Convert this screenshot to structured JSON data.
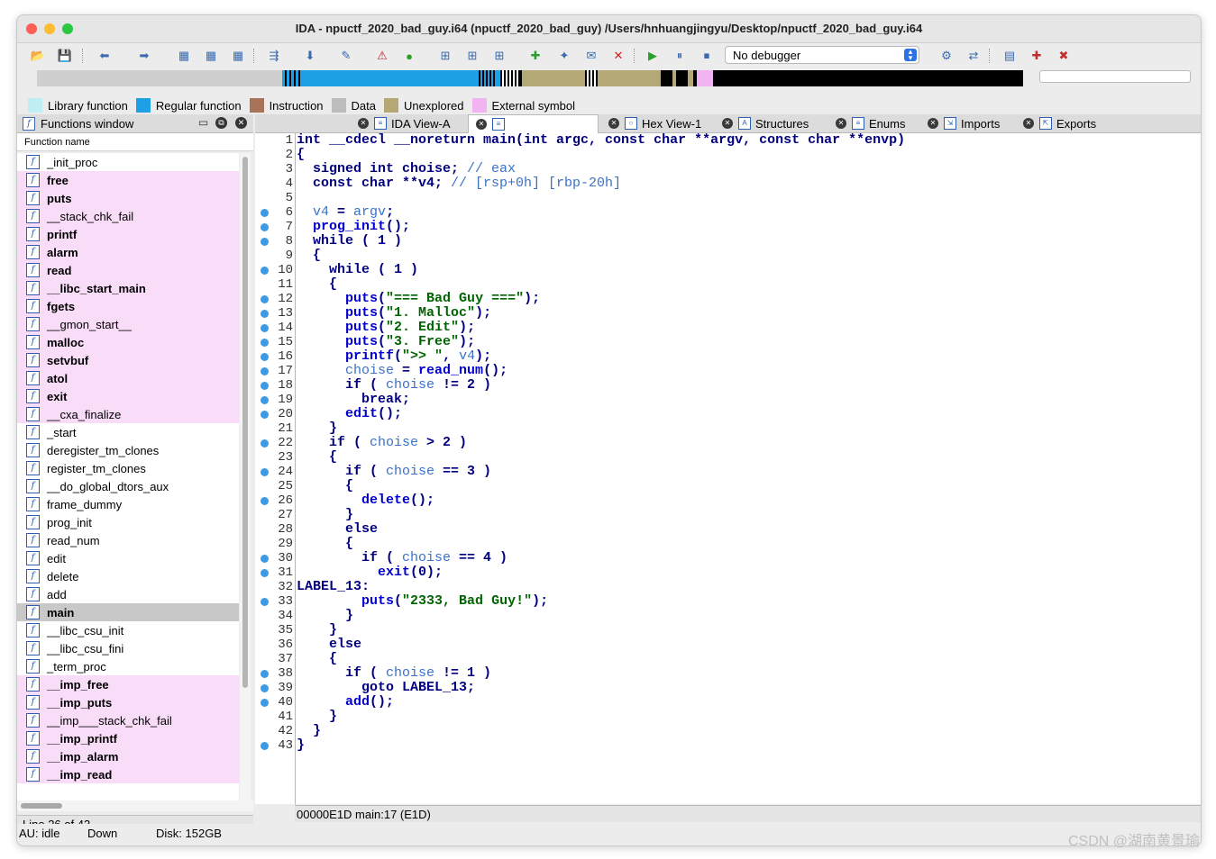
{
  "window": {
    "title": "IDA - npuctf_2020_bad_guy.i64 (npuctf_2020_bad_guy) /Users/hnhuangjingyu/Desktop/npuctf_2020_bad_guy.i64"
  },
  "toolbar": {
    "debugger_value": "No debugger"
  },
  "legend": [
    {
      "label": "Library function",
      "color": "#bfeff3"
    },
    {
      "label": "Regular function",
      "color": "#1ea0e6"
    },
    {
      "label": "Instruction",
      "color": "#a9725a"
    },
    {
      "label": "Data",
      "color": "#bcbcbc"
    },
    {
      "label": "Unexplored",
      "color": "#b5a877"
    },
    {
      "label": "External symbol",
      "color": "#f2b3f2"
    }
  ],
  "functions_panel": {
    "title": "Functions window",
    "column_header": "Function name",
    "line_status": "Line 26 of 43",
    "items": [
      {
        "name": "_init_proc",
        "lib": false,
        "bold": false
      },
      {
        "name": "free",
        "lib": true,
        "bold": true
      },
      {
        "name": "puts",
        "lib": true,
        "bold": true
      },
      {
        "name": "__stack_chk_fail",
        "lib": true,
        "bold": false
      },
      {
        "name": "printf",
        "lib": true,
        "bold": true
      },
      {
        "name": "alarm",
        "lib": true,
        "bold": true
      },
      {
        "name": "read",
        "lib": true,
        "bold": true
      },
      {
        "name": "__libc_start_main",
        "lib": true,
        "bold": true
      },
      {
        "name": "fgets",
        "lib": true,
        "bold": true
      },
      {
        "name": "__gmon_start__",
        "lib": true,
        "bold": false
      },
      {
        "name": "malloc",
        "lib": true,
        "bold": true
      },
      {
        "name": "setvbuf",
        "lib": true,
        "bold": true
      },
      {
        "name": "atol",
        "lib": true,
        "bold": true
      },
      {
        "name": "exit",
        "lib": true,
        "bold": true
      },
      {
        "name": "__cxa_finalize",
        "lib": true,
        "bold": false
      },
      {
        "name": "_start",
        "lib": false,
        "bold": false
      },
      {
        "name": "deregister_tm_clones",
        "lib": false,
        "bold": false
      },
      {
        "name": "register_tm_clones",
        "lib": false,
        "bold": false
      },
      {
        "name": "__do_global_dtors_aux",
        "lib": false,
        "bold": false
      },
      {
        "name": "frame_dummy",
        "lib": false,
        "bold": false
      },
      {
        "name": "prog_init",
        "lib": false,
        "bold": false
      },
      {
        "name": "read_num",
        "lib": false,
        "bold": false
      },
      {
        "name": "edit",
        "lib": false,
        "bold": false
      },
      {
        "name": "delete",
        "lib": false,
        "bold": false
      },
      {
        "name": "add",
        "lib": false,
        "bold": false
      },
      {
        "name": "main",
        "lib": false,
        "bold": true,
        "selected": true
      },
      {
        "name": "__libc_csu_init",
        "lib": false,
        "bold": false
      },
      {
        "name": "__libc_csu_fini",
        "lib": false,
        "bold": false
      },
      {
        "name": "_term_proc",
        "lib": false,
        "bold": false
      },
      {
        "name": "__imp_free",
        "lib": true,
        "bold": true
      },
      {
        "name": "__imp_puts",
        "lib": true,
        "bold": true
      },
      {
        "name": "__imp___stack_chk_fail",
        "lib": true,
        "bold": false
      },
      {
        "name": "__imp_printf",
        "lib": true,
        "bold": true
      },
      {
        "name": "__imp_alarm",
        "lib": true,
        "bold": true
      },
      {
        "name": "__imp_read",
        "lib": true,
        "bold": true
      }
    ]
  },
  "tabs": [
    {
      "label": "IDA View-A",
      "icon": "ida-view-icon"
    },
    {
      "label": "",
      "icon": "pseudocode-icon",
      "active": true
    },
    {
      "label": "Hex View-1",
      "icon": "hex-view-icon"
    },
    {
      "label": "Structures",
      "icon": "structures-icon"
    },
    {
      "label": "Enums",
      "icon": "enums-icon"
    },
    {
      "label": "Imports",
      "icon": "imports-icon"
    },
    {
      "label": "Exports",
      "icon": "exports-icon"
    }
  ],
  "code": {
    "lines": [
      {
        "n": "1",
        "dot": false,
        "html": "int __cdecl __noreturn main(int argc, const char **argv, const char **envp)"
      },
      {
        "n": "2",
        "dot": false,
        "html": "{"
      },
      {
        "n": "3",
        "dot": false,
        "html": "  signed int choise; <span class='c'>// eax</span>"
      },
      {
        "n": "4",
        "dot": false,
        "html": "  const char **v4; <span class='c'>// [rsp+0h] [rbp-20h]</span>"
      },
      {
        "n": "5",
        "dot": false,
        "html": ""
      },
      {
        "n": "6",
        "dot": true,
        "html": "  <span class='v'>v4</span> = <span class='v'>argv</span>;"
      },
      {
        "n": "7",
        "dot": true,
        "html": "  <span class='fnc'>prog_init</span>();"
      },
      {
        "n": "8",
        "dot": true,
        "html": "  while ( 1 )"
      },
      {
        "n": "9",
        "dot": false,
        "html": "  {"
      },
      {
        "n": "10",
        "dot": true,
        "html": "    while ( 1 )"
      },
      {
        "n": "11",
        "dot": false,
        "html": "    {"
      },
      {
        "n": "12",
        "dot": true,
        "html": "      <span class='fnc'>puts</span>(<span class='s'>\"=== Bad Guy ===\"</span>);"
      },
      {
        "n": "13",
        "dot": true,
        "html": "      <span class='fnc'>puts</span>(<span class='s'>\"1. Malloc\"</span>);"
      },
      {
        "n": "14",
        "dot": true,
        "html": "      <span class='fnc'>puts</span>(<span class='s'>\"2. Edit\"</span>);"
      },
      {
        "n": "15",
        "dot": true,
        "html": "      <span class='fnc'>puts</span>(<span class='s'>\"3. Free\"</span>);"
      },
      {
        "n": "16",
        "dot": true,
        "html": "      <span class='fnc'>printf</span>(<span class='s'>\"&gt;&gt; \"</span>, <span class='v'>v4</span>);"
      },
      {
        "n": "17",
        "dot": true,
        "html": "      <span class='v'>choise</span> = <span class='fnc'>read_num</span>();"
      },
      {
        "n": "18",
        "dot": true,
        "html": "      if ( <span class='v'>choise</span> != 2 )"
      },
      {
        "n": "19",
        "dot": true,
        "html": "        break;"
      },
      {
        "n": "20",
        "dot": true,
        "html": "      <span class='fnc'>edit</span>();"
      },
      {
        "n": "21",
        "dot": false,
        "html": "    }"
      },
      {
        "n": "22",
        "dot": true,
        "html": "    if ( <span class='v'>choise</span> &gt; 2 )"
      },
      {
        "n": "23",
        "dot": false,
        "html": "    {"
      },
      {
        "n": "24",
        "dot": true,
        "html": "      if ( <span class='v'>choise</span> == 3 )"
      },
      {
        "n": "25",
        "dot": false,
        "html": "      {"
      },
      {
        "n": "26",
        "dot": true,
        "html": "        <span class='fnc'>delete</span>();"
      },
      {
        "n": "27",
        "dot": false,
        "html": "      }"
      },
      {
        "n": "28",
        "dot": false,
        "html": "      else"
      },
      {
        "n": "29",
        "dot": false,
        "html": "      {"
      },
      {
        "n": "30",
        "dot": true,
        "html": "        if ( <span class='v'>choise</span> == 4 )"
      },
      {
        "n": "31",
        "dot": true,
        "html": "          <span class='fnc'>exit</span>(0);"
      },
      {
        "n": "32",
        "dot": false,
        "html": "LABEL_13:"
      },
      {
        "n": "33",
        "dot": true,
        "html": "        <span class='fnc'>puts</span>(<span class='s'>\"2333, Bad Guy!\"</span>);"
      },
      {
        "n": "34",
        "dot": false,
        "html": "      }"
      },
      {
        "n": "35",
        "dot": false,
        "html": "    }"
      },
      {
        "n": "36",
        "dot": false,
        "html": "    else"
      },
      {
        "n": "37",
        "dot": false,
        "html": "    {"
      },
      {
        "n": "38",
        "dot": true,
        "html": "      if ( <span class='v'>choise</span> != 1 )"
      },
      {
        "n": "39",
        "dot": true,
        "html": "        goto LABEL_13;"
      },
      {
        "n": "40",
        "dot": true,
        "html": "      <span class='fnc'>add</span>();"
      },
      {
        "n": "41",
        "dot": false,
        "html": "    }"
      },
      {
        "n": "42",
        "dot": false,
        "html": "  }"
      },
      {
        "n": "43",
        "dot": true,
        "html": "}"
      }
    ]
  },
  "address_bar": "00000E1D  main:17 (E1D)",
  "status": {
    "au": "AU:  idle",
    "direction": "Down",
    "disk": "Disk: 152GB"
  },
  "watermark": "CSDN @湖南黄景瑜"
}
